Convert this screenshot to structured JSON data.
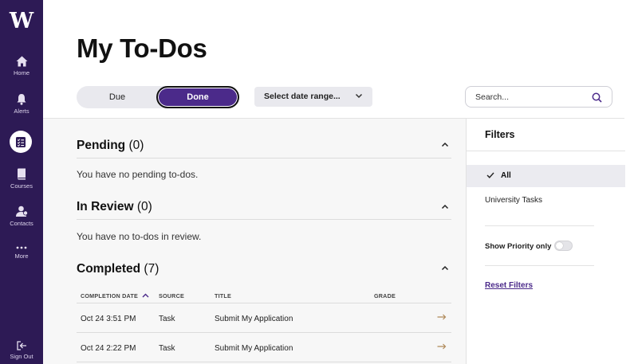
{
  "sidebar": {
    "logo": "W",
    "items": [
      {
        "label": "Home",
        "icon": "home-icon"
      },
      {
        "label": "Alerts",
        "icon": "bell-icon"
      },
      {
        "label": "",
        "icon": "checklist-icon",
        "active": true
      },
      {
        "label": "Courses",
        "icon": "book-icon"
      },
      {
        "label": "Contacts",
        "icon": "contacts-icon"
      },
      {
        "label": "More",
        "icon": "more-dots-icon"
      },
      {
        "label": "Sign Out",
        "icon": "sign-out-icon"
      }
    ],
    "bg_color": "#2d1a55"
  },
  "header": {
    "title": "My To-Dos",
    "toggle": {
      "due_label": "Due",
      "done_label": "Done",
      "selected": "Done"
    },
    "date_range": {
      "label": "Select date range..."
    },
    "search": {
      "placeholder": "Search...",
      "value": ""
    }
  },
  "sections": {
    "pending": {
      "title": "Pending",
      "count": "(0)",
      "empty_text": "You have no pending to-dos."
    },
    "in_review": {
      "title": "In Review",
      "count": "(0)",
      "empty_text": "You have no to-dos in review."
    },
    "completed": {
      "title": "Completed",
      "count": "(7)",
      "columns": [
        "COMPLETION DATE",
        "SOURCE",
        "TITLE",
        "GRADE"
      ],
      "rows": [
        {
          "date": "Oct 24 3:51 PM",
          "source": "Task",
          "title": "Submit My Application",
          "grade": ""
        },
        {
          "date": "Oct 24 2:22 PM",
          "source": "Task",
          "title": "Submit My Application",
          "grade": ""
        }
      ]
    }
  },
  "filters": {
    "title": "Filters",
    "options": [
      {
        "label": "All",
        "selected": true
      },
      {
        "label": "University Tasks",
        "selected": false
      }
    ],
    "priority_label": "Show Priority only",
    "priority_on": false,
    "reset_label": "Reset Filters"
  },
  "colors": {
    "accent": "#4b2a8a",
    "sidebar": "#2d1a55"
  }
}
